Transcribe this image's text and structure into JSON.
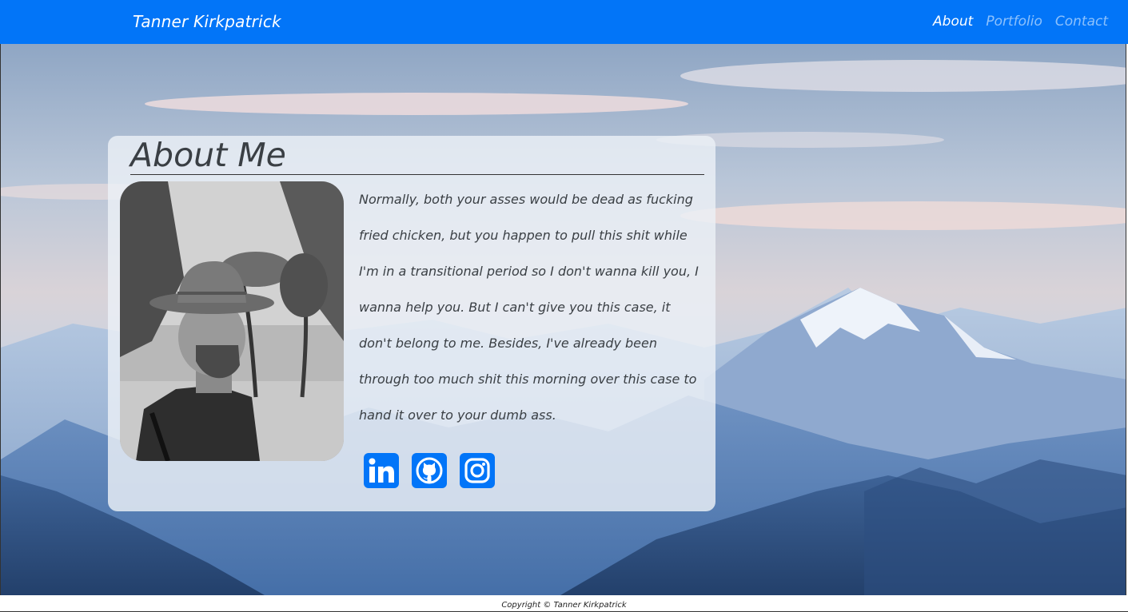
{
  "navbar": {
    "brand": "Tanner Kirkpatrick",
    "links": [
      {
        "label": "About",
        "active": true
      },
      {
        "label": "Portfolio",
        "active": false
      },
      {
        "label": "Contact",
        "active": false
      }
    ],
    "background_color": "#0275f8"
  },
  "about": {
    "title": "About Me",
    "bio": "Normally, both your asses would be dead as fucking fried chicken, but you happen to pull this shit while I'm in a transitional period so I don't wanna kill you, I wanna help you. But I can't give you this case, it don't belong to me. Besides, I've already been through too much shit this morning over this case to hand it over to your dumb ass.",
    "socials": [
      {
        "icon": "linkedin-icon"
      },
      {
        "icon": "github-icon"
      },
      {
        "icon": "instagram-icon"
      }
    ],
    "social_color": "#0275f8"
  },
  "footer": {
    "copyright": "Copyright © Tanner Kirkpatrick"
  }
}
